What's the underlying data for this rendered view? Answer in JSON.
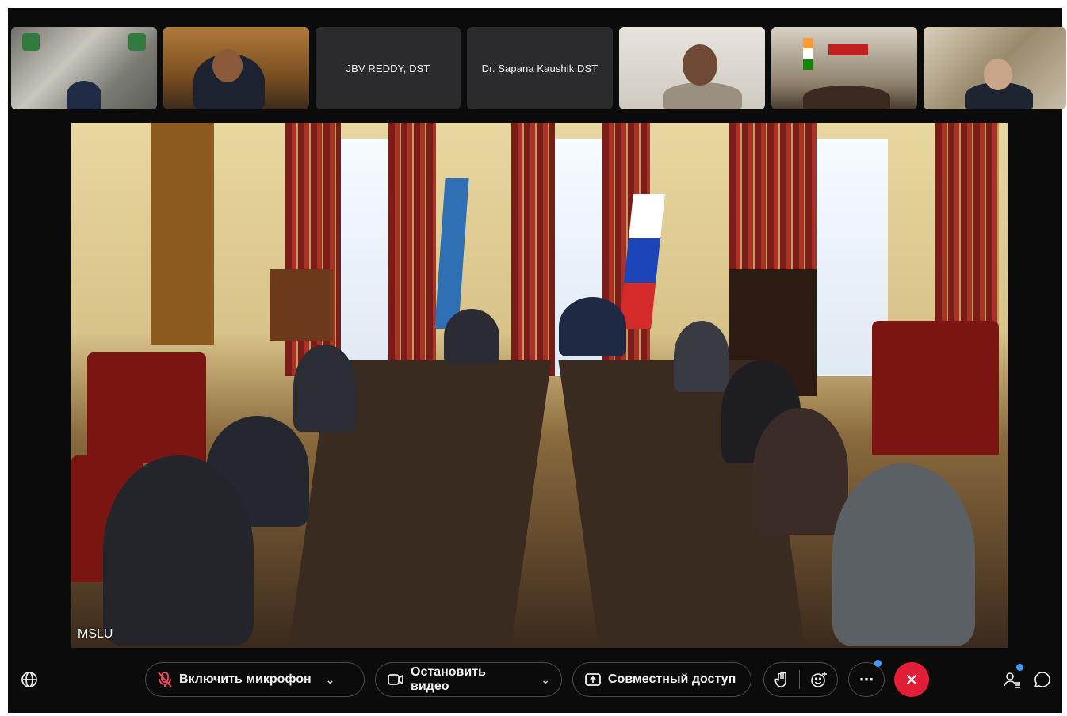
{
  "participants": [
    {
      "name": "",
      "kind": "video"
    },
    {
      "name": "",
      "kind": "video"
    },
    {
      "name": "JBV REDDY, DST",
      "kind": "name-only"
    },
    {
      "name": "Dr. Sapana Kaushik DST",
      "kind": "name-only"
    },
    {
      "name": "",
      "kind": "video"
    },
    {
      "name": "",
      "kind": "video"
    },
    {
      "name": "",
      "kind": "video"
    }
  ],
  "main_video": {
    "label": "MSLU"
  },
  "toolbar": {
    "mic_label": "Включить микрофон",
    "video_label": "Остановить видео",
    "share_label": "Совместный доступ"
  },
  "colors": {
    "end_call": "#e21d35",
    "notification_dot": "#3f9bff",
    "background": "#0b0b0c"
  }
}
